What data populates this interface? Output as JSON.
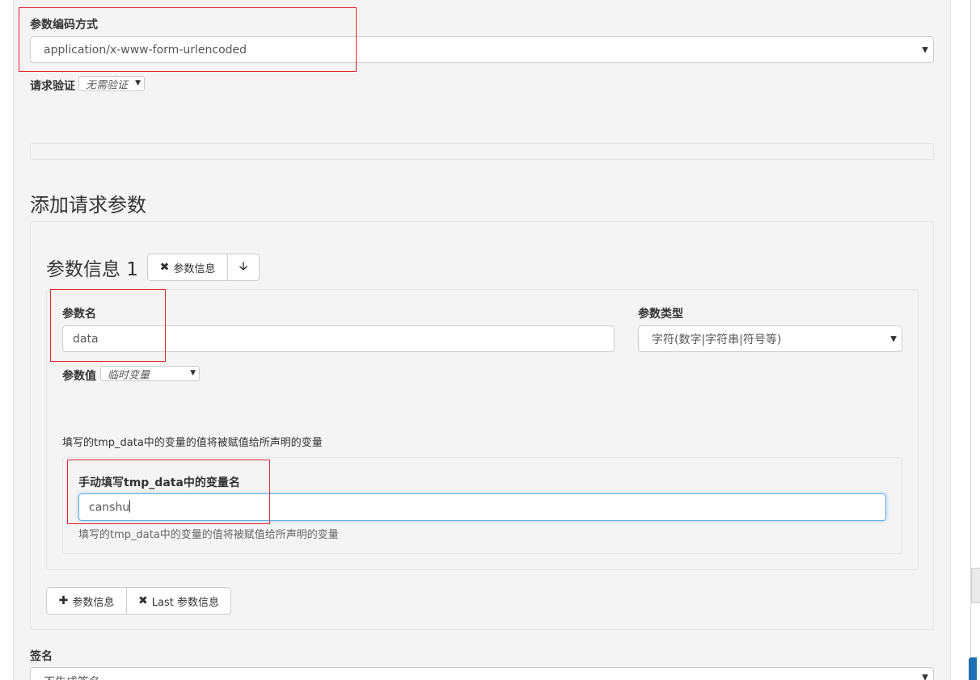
{
  "encoding": {
    "label": "参数编码方式",
    "value": "application/x-www-form-urlencoded"
  },
  "auth": {
    "label": "请求验证",
    "value": "无需验证"
  },
  "section_title": "添加请求参数",
  "param": {
    "heading": "参数信息 1",
    "remove_button": "参数信息",
    "name_label": "参数名",
    "name_value": "data",
    "type_label": "参数类型",
    "type_value": "字符(数字|字符串|符号等)",
    "value_label": "参数值",
    "value_type": "临时变量",
    "help_text": "填写的tmp_data中的变量的值将被赋值给所声明的变量",
    "var_label": "手动填写tmp_data中的变量名",
    "var_value": "canshu",
    "var_help": "填写的tmp_data中的变量的值将被赋值给所声明的变量"
  },
  "footer_buttons": {
    "add": "参数信息",
    "remove_last": "Last 参数信息"
  },
  "signature": {
    "label": "签名",
    "value": "不生成签名"
  },
  "colors": {
    "highlight_box": "#e3262c",
    "focus_border": "#66afe9",
    "panel_bg": "#f4f4f4"
  },
  "icons": [
    "times-icon",
    "arrow-down-icon",
    "plus-icon",
    "caret-down-icon"
  ]
}
